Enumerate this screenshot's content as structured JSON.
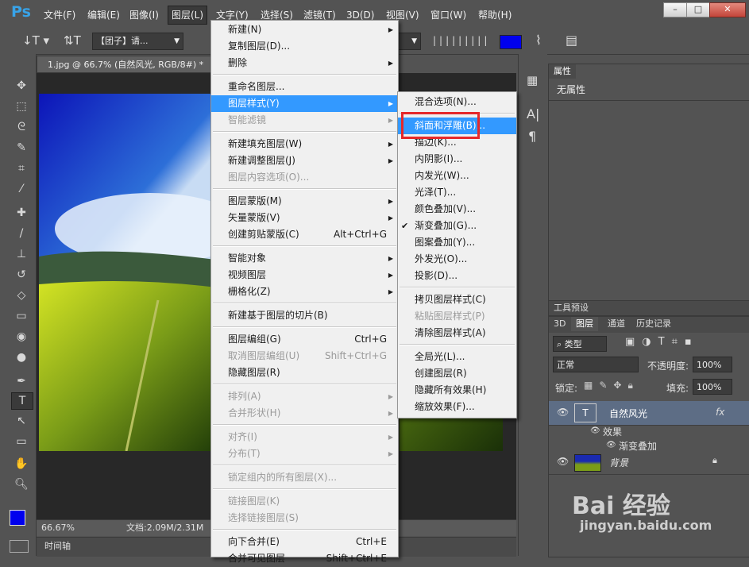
{
  "menubar": {
    "logo": "Ps",
    "items": [
      "文件(F)",
      "编辑(E)",
      "图像(I)",
      "图层(L)",
      "文字(Y)",
      "选择(S)",
      "滤镜(T)",
      "3D(D)",
      "视图(V)",
      "窗口(W)",
      "帮助(H)"
    ],
    "window_buttons": [
      "–",
      "□",
      "✕"
    ]
  },
  "optbar": {
    "font_family": "【团子】请...",
    "color_swatch": "#0000ee"
  },
  "document": {
    "tab_label": "1.jpg @ 66.7% (自然风光, RGB/8#) *",
    "zoom": "66.67%",
    "doc_size": "文档:2.09M/2.31M",
    "timeline": "时间轴"
  },
  "layer_menu": {
    "items": [
      {
        "label": "新建(N)",
        "arrow": true,
        "disabled": false
      },
      {
        "label": "复制图层(D)...",
        "disabled": false
      },
      {
        "label": "删除",
        "arrow": true,
        "disabled": false
      },
      {
        "sep": true
      },
      {
        "label": "重命名图层...",
        "disabled": false
      },
      {
        "label": "图层样式(Y)",
        "arrow": true,
        "highlight": true
      },
      {
        "label": "智能滤镜",
        "arrow": true,
        "disabled": true
      },
      {
        "sep": true
      },
      {
        "label": "新建填充图层(W)",
        "arrow": true
      },
      {
        "label": "新建调整图层(J)",
        "arrow": true
      },
      {
        "label": "图层内容选项(O)...",
        "disabled": true
      },
      {
        "sep": true
      },
      {
        "label": "图层蒙版(M)",
        "arrow": true
      },
      {
        "label": "矢量蒙版(V)",
        "arrow": true
      },
      {
        "label": "创建剪贴蒙版(C)",
        "shortcut": "Alt+Ctrl+G"
      },
      {
        "sep": true
      },
      {
        "label": "智能对象",
        "arrow": true
      },
      {
        "label": "视频图层",
        "arrow": true
      },
      {
        "label": "栅格化(Z)",
        "arrow": true
      },
      {
        "sep": true
      },
      {
        "label": "新建基于图层的切片(B)"
      },
      {
        "sep": true
      },
      {
        "label": "图层编组(G)",
        "shortcut": "Ctrl+G"
      },
      {
        "label": "取消图层编组(U)",
        "shortcut": "Shift+Ctrl+G",
        "disabled": true
      },
      {
        "label": "隐藏图层(R)"
      },
      {
        "sep": true
      },
      {
        "label": "排列(A)",
        "arrow": true,
        "disabled": true
      },
      {
        "label": "合并形状(H)",
        "arrow": true,
        "disabled": true
      },
      {
        "sep": true
      },
      {
        "label": "对齐(I)",
        "arrow": true,
        "disabled": true
      },
      {
        "label": "分布(T)",
        "arrow": true,
        "disabled": true
      },
      {
        "sep": true
      },
      {
        "label": "锁定组内的所有图层(X)...",
        "disabled": true
      },
      {
        "sep": true
      },
      {
        "label": "链接图层(K)",
        "disabled": true
      },
      {
        "label": "选择链接图层(S)",
        "disabled": true
      },
      {
        "sep": true
      },
      {
        "label": "向下合并(E)",
        "shortcut": "Ctrl+E"
      },
      {
        "label": "合并可见图层",
        "shortcut": "Shift+Ctrl+E"
      }
    ]
  },
  "style_submenu": {
    "items": [
      {
        "label": "混合选项(N)..."
      },
      {
        "sep": true
      },
      {
        "label": "斜面和浮雕(B)...",
        "highlight": true
      },
      {
        "label": "描边(K)..."
      },
      {
        "label": "内阴影(I)..."
      },
      {
        "label": "内发光(W)..."
      },
      {
        "label": "光泽(T)..."
      },
      {
        "label": "颜色叠加(V)..."
      },
      {
        "label": "渐变叠加(G)...",
        "checked": true
      },
      {
        "label": "图案叠加(Y)..."
      },
      {
        "label": "外发光(O)..."
      },
      {
        "label": "投影(D)..."
      },
      {
        "sep": true
      },
      {
        "label": "拷贝图层样式(C)"
      },
      {
        "label": "粘贴图层样式(P)",
        "disabled": true
      },
      {
        "label": "清除图层样式(A)"
      },
      {
        "sep": true
      },
      {
        "label": "全局光(L)..."
      },
      {
        "label": "创建图层(R)"
      },
      {
        "label": "隐藏所有效果(H)"
      },
      {
        "label": "缩放效果(F)..."
      }
    ]
  },
  "properties": {
    "tab": "属性",
    "content": "无属性"
  },
  "tool_presets": {
    "tab": "工具预设"
  },
  "layers_panel": {
    "tabs": [
      "3D",
      "图层",
      "通道",
      "历史记录"
    ],
    "filter": "类型",
    "blend_mode": "正常",
    "opacity_label": "不透明度:",
    "opacity": "100%",
    "lock_label": "锁定:",
    "fill_label": "填充:",
    "fill": "100%",
    "text_layer": "自然风光",
    "effects_label": "效果",
    "effect_item": "渐变叠加",
    "fx": "fx",
    "bg_layer": "背景",
    "thumb_text": "T"
  },
  "watermark": {
    "brand": "Bai 经验",
    "url": "jingyan.baidu.com"
  }
}
